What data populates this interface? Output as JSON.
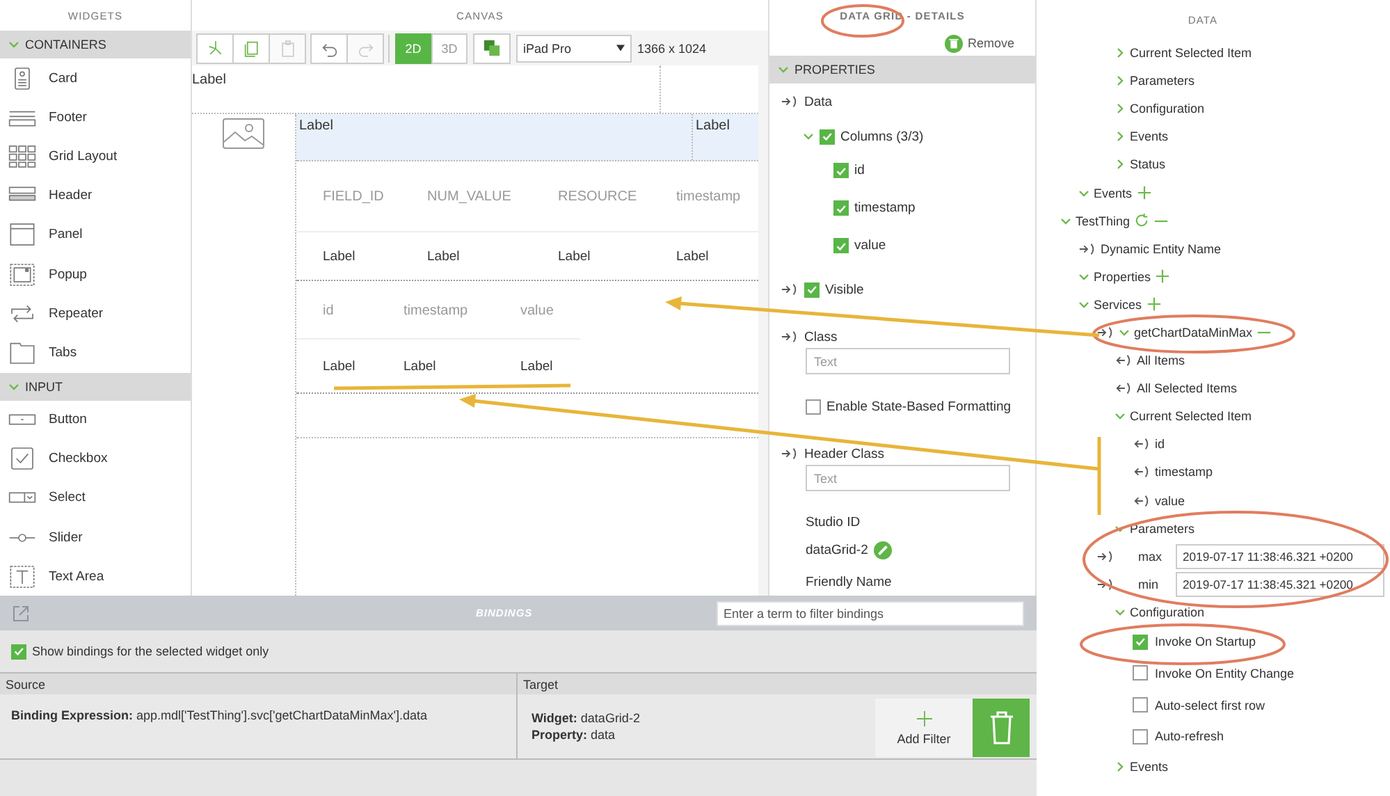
{
  "widgets": {
    "title": "WIDGETS",
    "groups": [
      {
        "label": "CONTAINERS",
        "expanded": true,
        "items": [
          "Card",
          "Footer",
          "Grid Layout",
          "Header",
          "Panel",
          "Popup",
          "Repeater",
          "Tabs"
        ]
      },
      {
        "label": "INPUT",
        "expanded": true,
        "items": [
          "Button",
          "Checkbox",
          "Select",
          "Slider",
          "Text Area"
        ]
      }
    ]
  },
  "canvas": {
    "title": "CANVAS",
    "tools": [
      {
        "disabled": false
      },
      {
        "disabled": false
      },
      {
        "disabled": true
      },
      {
        "disabled": false
      },
      {
        "disabled": true
      }
    ],
    "view_modes": [
      {
        "label": "2D",
        "selected": true
      },
      {
        "label": "3D",
        "selected": false
      }
    ],
    "device": "iPad Pro",
    "resolution": "1366 x 1024",
    "top_label": "Label",
    "header": {
      "selected": true,
      "labels": [
        "Label",
        "Label"
      ]
    },
    "grids": [
      {
        "columns": [
          "FIELD_ID",
          "NUM_VALUE",
          "RESOURCE",
          "timestamp"
        ],
        "row": [
          "Label",
          "Label",
          "Label",
          "Label"
        ]
      },
      {
        "columns": [
          "id",
          "timestamp",
          "value"
        ],
        "row": [
          "Label",
          "Label",
          "Label"
        ]
      }
    ]
  },
  "details": {
    "title": "DATA GRID - DETAILS",
    "remove": "Remove",
    "section": {
      "label": "PROPERTIES",
      "expanded": true
    },
    "items": [
      {
        "kind": "binding",
        "label": "Data"
      },
      {
        "kind": "columns",
        "label": "Columns (3/3)",
        "expanded": true,
        "checked": true,
        "children": [
          {
            "label": "id",
            "checked": true
          },
          {
            "label": "timestamp",
            "checked": true
          },
          {
            "label": "value",
            "checked": true
          }
        ]
      },
      {
        "kind": "binding_checkbox",
        "label": "Visible",
        "checked": true
      },
      {
        "kind": "binding_field",
        "label": "Class",
        "placeholder": "Text"
      },
      {
        "kind": "checkbox",
        "label": "Enable State-Based Formatting",
        "checked": false
      },
      {
        "kind": "binding_field",
        "label": "Header Class",
        "placeholder": "Text"
      },
      {
        "kind": "static",
        "label": "Studio ID",
        "value": "dataGrid-2"
      },
      {
        "kind": "heading",
        "label": "Friendly Name"
      }
    ]
  },
  "data_panel": {
    "title": "DATA",
    "partial_items": [
      {
        "kind": "group",
        "label": "Current Selected Item",
        "expanded": false
      },
      {
        "kind": "group",
        "label": "Parameters",
        "expanded": false
      },
      {
        "kind": "group",
        "label": "Configuration",
        "expanded": false
      },
      {
        "kind": "group",
        "label": "Events",
        "expanded": false
      },
      {
        "kind": "group",
        "label": "Status",
        "expanded": false
      }
    ],
    "events_group": {
      "kind": "group",
      "label": "Events",
      "expanded": true,
      "can_add": true
    },
    "tree": [
      {
        "kind": "entity",
        "label": "TestThing",
        "expanded": true,
        "can_remove": true,
        "children": [
          {
            "kind": "input",
            "label": "Dynamic Entity Name"
          },
          {
            "kind": "group",
            "label": "Properties",
            "expanded": true,
            "can_add": true
          },
          {
            "kind": "group",
            "label": "Services",
            "expanded": true,
            "can_add": true,
            "children": [
              {
                "kind": "service",
                "label": "getChartDataMinMax",
                "expanded": true,
                "can_remove": true,
                "children": [
                  {
                    "kind": "output",
                    "label": "All Items"
                  },
                  {
                    "kind": "output",
                    "label": "All Selected Items"
                  },
                  {
                    "kind": "group",
                    "label": "Current Selected Item",
                    "expanded": true,
                    "children": [
                      {
                        "kind": "output",
                        "label": "id"
                      },
                      {
                        "kind": "output",
                        "label": "timestamp"
                      },
                      {
                        "kind": "output",
                        "label": "value"
                      }
                    ]
                  },
                  {
                    "kind": "group",
                    "label": "Parameters",
                    "expanded": true,
                    "children": [
                      {
                        "kind": "parameter",
                        "label": "max",
                        "value": "2019-07-17 11:38:46.321 +0200"
                      },
                      {
                        "kind": "parameter",
                        "label": "min",
                        "value": "2019-07-17 11:38:45.321 +0200"
                      }
                    ]
                  },
                  {
                    "kind": "group",
                    "label": "Configuration",
                    "expanded": true,
                    "children": [
                      {
                        "kind": "option",
                        "label": "Invoke On Startup",
                        "checked": true
                      },
                      {
                        "kind": "option",
                        "label": "Invoke On Entity Change",
                        "checked": false
                      },
                      {
                        "kind": "option",
                        "label": "Auto-select first row",
                        "checked": false
                      },
                      {
                        "kind": "option",
                        "label": "Auto-refresh",
                        "checked": false
                      }
                    ]
                  },
                  {
                    "kind": "group",
                    "label": "Events",
                    "expanded": false
                  }
                ]
              }
            ]
          }
        ]
      }
    ]
  },
  "bindings": {
    "title": "BINDINGS",
    "filter_placeholder": "Enter a term to filter bindings",
    "selected_only": {
      "label": "Show bindings for the selected widget only",
      "checked": true
    },
    "columns": [
      "Source",
      "Target"
    ],
    "rows": [
      {
        "source": "**Binding Expression:** app.mdl['TestThing'].svc['getChartDataMinMax'].data",
        "target": [
          "**Widget:** dataGrid-2",
          "**Property:** data"
        ]
      }
    ],
    "add_filter": "Add Filter"
  }
}
